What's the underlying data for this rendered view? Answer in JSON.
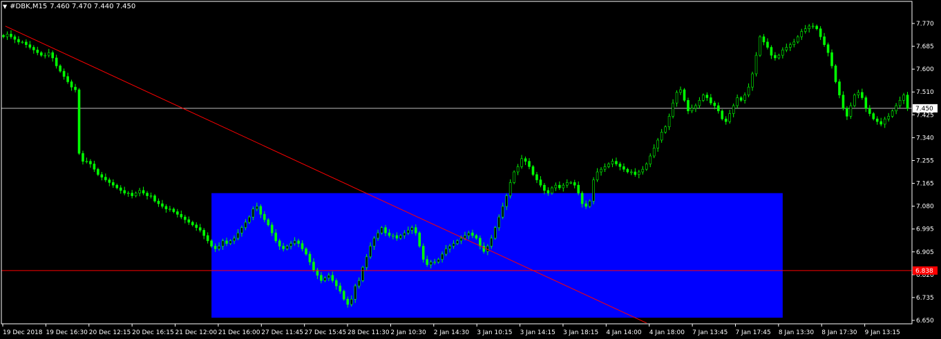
{
  "header": {
    "menu_icon": "triangle-down-icon",
    "symbol": "#DBK,M15",
    "ohlc": "7.460 7.470 7.440 7.450"
  },
  "colors": {
    "background": "#000000",
    "frame": "#ffffff",
    "candle": "#00ff00",
    "bid_line": "#c0c0c0",
    "horizontal_line": "#ff0000",
    "trend_line": "#ff0000",
    "rectangle": "#0000ff",
    "level_label_bg": "#ff0000"
  },
  "price_axis": {
    "labels": [
      "7.770",
      "7.685",
      "7.600",
      "7.510",
      "7.425",
      "7.340",
      "7.255",
      "7.165",
      "7.080",
      "6.995",
      "6.905",
      "6.820",
      "6.735",
      "6.650"
    ]
  },
  "time_axis": {
    "labels": [
      "19 Dec 2018",
      "19 Dec 16:30",
      "20 Dec 12:15",
      "20 Dec 16:15",
      "21 Dec 12:00",
      "21 Dec 16:00",
      "27 Dec 11:45",
      "27 Dec 15:45",
      "28 Dec 11:30",
      "2 Jan 10:30",
      "2 Jan 14:30",
      "3 Jan 10:15",
      "3 Jan 14:15",
      "3 Jan 18:15",
      "4 Jan 14:00",
      "4 Jan 18:00",
      "7 Jan 13:45",
      "7 Jan 17:45",
      "8 Jan 13:30",
      "8 Jan 17:30",
      "9 Jan 13:15"
    ]
  },
  "bid_marker": "7.450",
  "level_marker": "6.838",
  "chart_data": {
    "type": "candlestick",
    "symbol": "#DBK",
    "timeframe": "M15",
    "current_price": 7.45,
    "ylim": [
      6.65,
      7.8
    ],
    "horizontal_line": 6.838,
    "trend_line": [
      [
        0.5,
        7.76
      ],
      [
        170,
        6.64
      ]
    ],
    "rectangle": {
      "x_range": [
        55,
        206
      ],
      "y_range": [
        6.66,
        7.13
      ]
    },
    "closes": [
      7.72,
      7.73,
      7.72,
      7.71,
      7.7,
      7.7,
      7.69,
      7.68,
      7.67,
      7.66,
      7.65,
      7.65,
      7.66,
      7.64,
      7.61,
      7.59,
      7.57,
      7.55,
      7.53,
      7.52,
      7.28,
      7.25,
      7.25,
      7.24,
      7.22,
      7.2,
      7.19,
      7.18,
      7.17,
      7.16,
      7.15,
      7.14,
      7.13,
      7.13,
      7.12,
      7.13,
      7.14,
      7.13,
      7.12,
      7.12,
      7.1,
      7.09,
      7.08,
      7.07,
      7.07,
      7.06,
      7.05,
      7.04,
      7.03,
      7.02,
      7.01,
      7.0,
      6.99,
      6.97,
      6.95,
      6.93,
      6.92,
      6.93,
      6.95,
      6.94,
      6.95,
      6.96,
      6.98,
      7.0,
      7.02,
      7.04,
      7.07,
      7.08,
      7.05,
      7.03,
      7.01,
      6.98,
      6.95,
      6.93,
      6.92,
      6.93,
      6.94,
      6.95,
      6.94,
      6.92,
      6.9,
      6.87,
      6.84,
      6.82,
      6.8,
      6.81,
      6.82,
      6.8,
      6.78,
      6.76,
      6.73,
      6.71,
      6.73,
      6.78,
      6.8,
      6.85,
      6.89,
      6.93,
      6.96,
      6.98,
      7.0,
      6.98,
      6.97,
      6.97,
      6.96,
      6.97,
      6.98,
      6.99,
      7.0,
      6.98,
      6.93,
      6.88,
      6.86,
      6.87,
      6.87,
      6.88,
      6.9,
      6.92,
      6.93,
      6.94,
      6.95,
      6.96,
      6.97,
      6.98,
      6.97,
      6.96,
      6.93,
      6.91,
      6.93,
      6.96,
      7.0,
      7.04,
      7.08,
      7.12,
      7.17,
      7.21,
      7.23,
      7.26,
      7.25,
      7.23,
      7.2,
      7.18,
      7.16,
      7.14,
      7.13,
      7.15,
      7.16,
      7.15,
      7.16,
      7.17,
      7.17,
      7.16,
      7.13,
      7.09,
      7.08,
      7.1,
      7.18,
      7.21,
      7.22,
      7.23,
      7.24,
      7.25,
      7.24,
      7.23,
      7.22,
      7.21,
      7.21,
      7.2,
      7.21,
      7.22,
      7.24,
      7.27,
      7.3,
      7.33,
      7.36,
      7.38,
      7.42,
      7.47,
      7.51,
      7.52,
      7.48,
      7.44,
      7.45,
      7.46,
      7.48,
      7.5,
      7.49,
      7.47,
      7.46,
      7.44,
      7.41,
      7.4,
      7.43,
      7.46,
      7.49,
      7.48,
      7.5,
      7.53,
      7.58,
      7.65,
      7.72,
      7.7,
      7.68,
      7.65,
      7.64,
      7.65,
      7.67,
      7.68,
      7.69,
      7.7,
      7.72,
      7.74,
      7.75,
      7.76,
      7.76,
      7.75,
      7.72,
      7.69,
      7.66,
      7.61,
      7.55,
      7.5,
      7.45,
      7.42,
      7.46,
      7.5,
      7.51,
      7.49,
      7.45,
      7.43,
      7.41,
      7.4,
      7.39,
      7.41,
      7.42,
      7.44,
      7.46,
      7.48,
      7.5,
      7.45
    ]
  }
}
